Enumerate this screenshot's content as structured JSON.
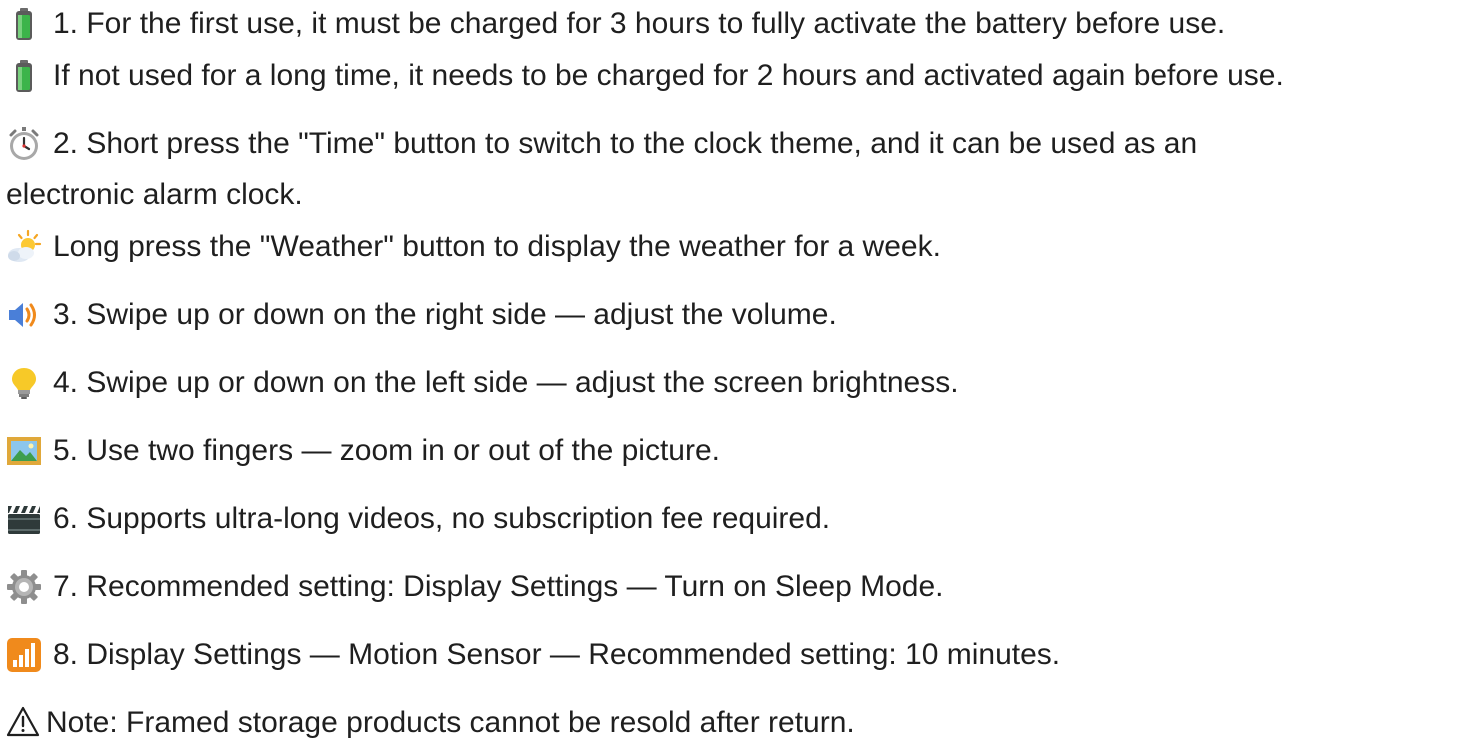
{
  "instructions": {
    "lines": [
      {
        "icon": "battery-icon",
        "text": "1. For the first use, it must be charged for 3 hours to fully activate the battery before use."
      },
      {
        "icon": "battery-icon",
        "text": "If not used for a long time, it needs to be charged for 2 hours and activated again before use."
      },
      {
        "icon": "alarm-clock-icon",
        "text": "2. Short press the \"Time\" button to switch to the clock theme, and it can be used as an"
      },
      {
        "icon": "",
        "text": "electronic alarm clock."
      },
      {
        "icon": "sun-behind-cloud-icon",
        "text": "Long press the \"Weather\" button to display the weather for a week."
      },
      {
        "icon": "speaker-high-volume-icon",
        "text": "3. Swipe up or down on the right side — adjust the volume."
      },
      {
        "icon": "light-bulb-icon",
        "text": "4. Swipe up or down on the left side — adjust the screen brightness."
      },
      {
        "icon": "framed-picture-icon",
        "text": "5. Use two fingers — zoom in or out of the picture."
      },
      {
        "icon": "clapper-board-icon",
        "text": "6. Supports ultra-long videos, no subscription fee required."
      },
      {
        "icon": "gear-icon",
        "text": "7. Recommended setting: Display Settings — Turn on Sleep Mode."
      },
      {
        "icon": "antenna-bars-icon",
        "text": "8. Display Settings — Motion Sensor — Recommended setting: 10 minutes."
      },
      {
        "icon": "warning-icon",
        "text": "Note: Framed storage products cannot be resold after return."
      }
    ]
  },
  "colors": {
    "text": "#1f1f1f",
    "battery_green": "#3cb44a",
    "bulb_yellow": "#f7c928",
    "speaker_blue": "#4a7fd8",
    "antenna_orange": "#f08a1c"
  }
}
